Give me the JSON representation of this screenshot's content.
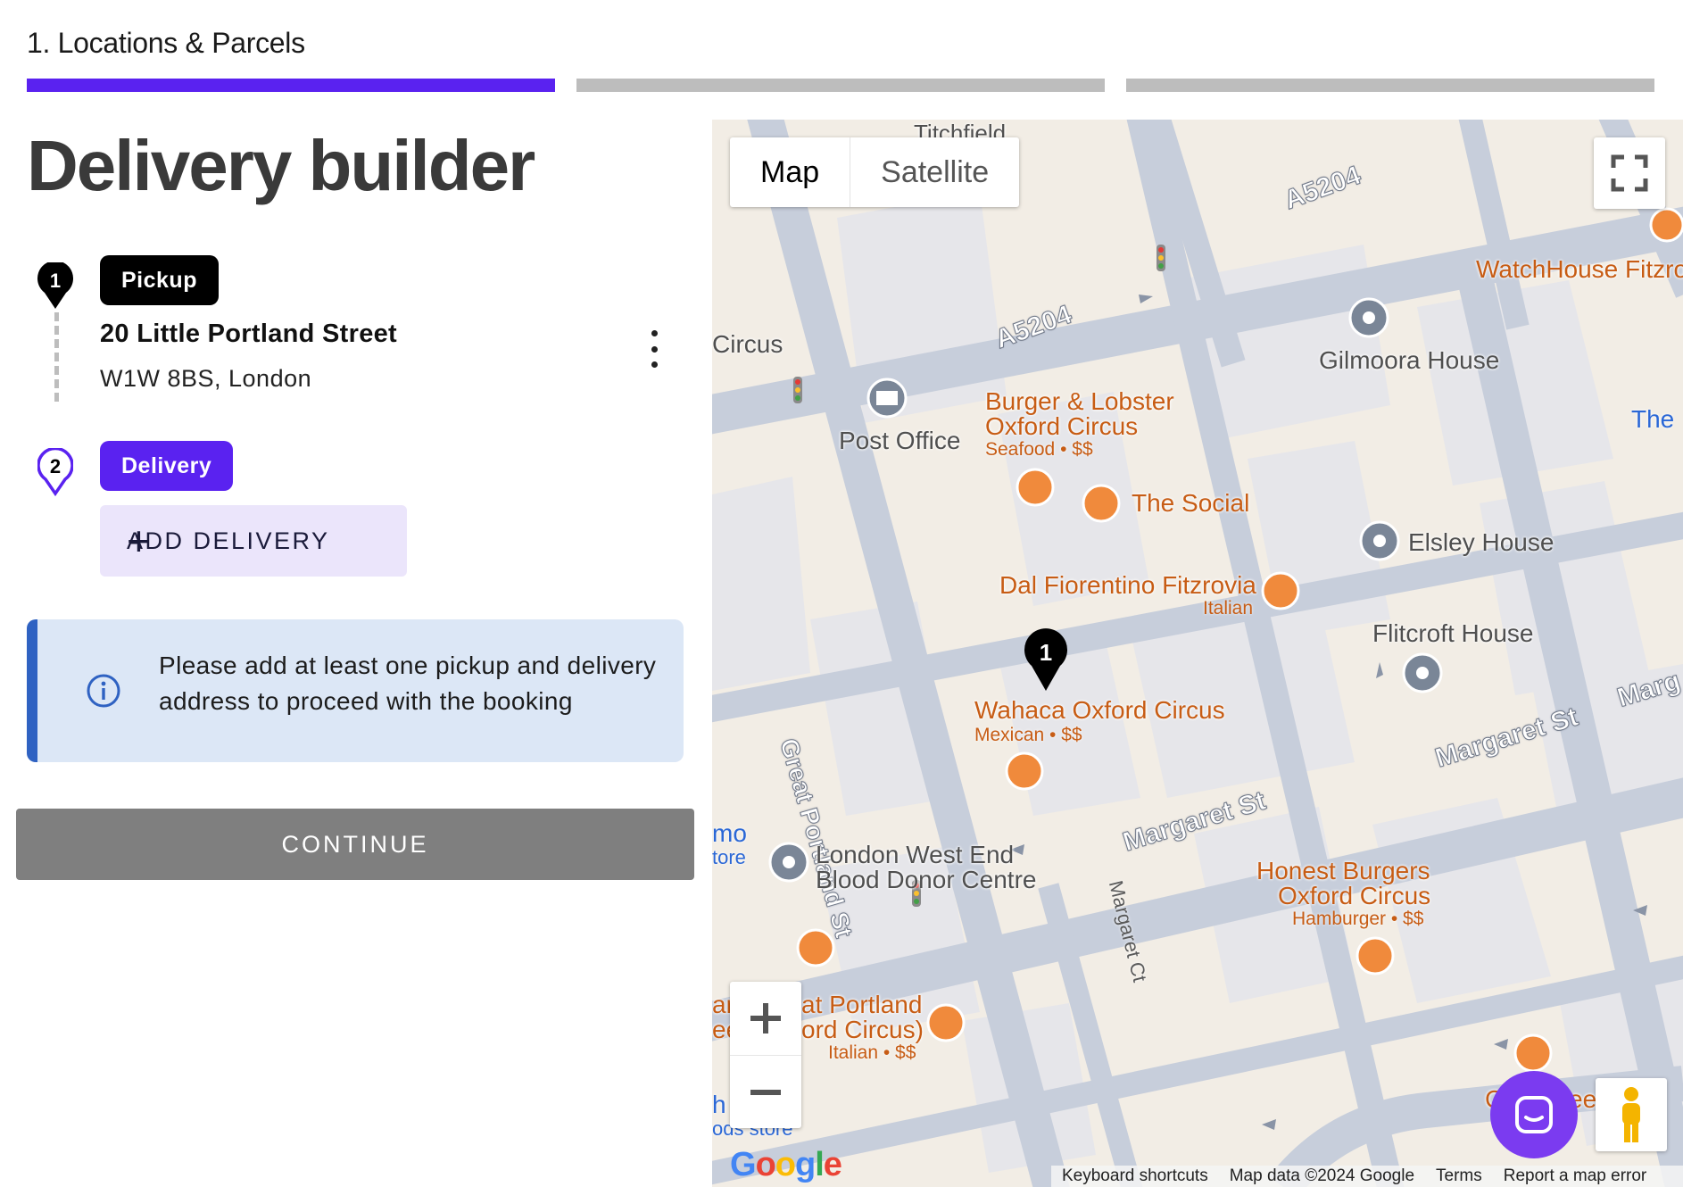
{
  "stepper": {
    "current_label": "1. Locations & Parcels",
    "steps": [
      {
        "state": "active"
      },
      {
        "state": "inactive"
      },
      {
        "state": "inactive"
      }
    ]
  },
  "page_title": "Delivery builder",
  "stops": {
    "pickup": {
      "number": "1",
      "badge": "Pickup",
      "address_line1": "20 Little Portland Street",
      "address_line2": "W1W 8BS, London"
    },
    "delivery": {
      "number": "2",
      "badge": "Delivery",
      "add_button_label": "ADD DELIVERY"
    }
  },
  "info_message": "Please add at least one pickup and delivery address to proceed with the booking",
  "continue_label": "CONTINUE",
  "colors": {
    "accent": "#5a22f0",
    "info_bg": "#dce7f6",
    "info_border": "#2f62c2",
    "disabled_button": "#7f7f7f"
  },
  "map": {
    "type_selected": "Map",
    "type_other": "Satellite",
    "marker_number": "1",
    "footer": [
      "Keyboard shortcuts",
      "Map data ©2024 Google",
      "Terms",
      "Report a map error"
    ],
    "logo": "Google",
    "labels": {
      "titchfield": "Titchfield",
      "a5204_top": "A5204",
      "a5204_mid": "A5204",
      "circus": "Circus",
      "watchhouse": "WatchHouse Fitzro",
      "gilmoora": "Gilmoora House",
      "the": "The",
      "post_office": "Post Office",
      "burger_lobster_1": "Burger & Lobster",
      "burger_lobster_2": "Oxford Circus",
      "burger_lobster_sub": "Seafood • $$",
      "the_social": "The Social",
      "elsley": "Elsley House",
      "dal_fiorentino": "Dal Fiorentino Fitzrovia",
      "dal_fiorentino_sub": "Italian",
      "great_portland": "Great Portland St",
      "flitcroft": "Flitcroft House",
      "wahaca": "Wahaca Oxford Circus",
      "wahaca_sub": "Mexican • $$",
      "margaret_st_1": "Margaret St",
      "margaret_st_2": "Margaret St",
      "marg": "Marg",
      "mo": "mo",
      "tore": "tore",
      "blood_donor_1": "London West End",
      "blood_donor_2": "Blood Donor Centre",
      "margaret_ct": "Margaret Ct",
      "honest_1": "Honest Burgers",
      "honest_2": "Oxford Circus",
      "honest_sub": "Hamburger • $$",
      "at_portland": "at Portland",
      "ord_circus": "ord Circus)",
      "italian_sub": "Italian • $$",
      "ar": "ar",
      "ee": "ee",
      "h": "h",
      "ods_store": "ods store",
      "c": "C",
      "ee2": "ee"
    }
  }
}
